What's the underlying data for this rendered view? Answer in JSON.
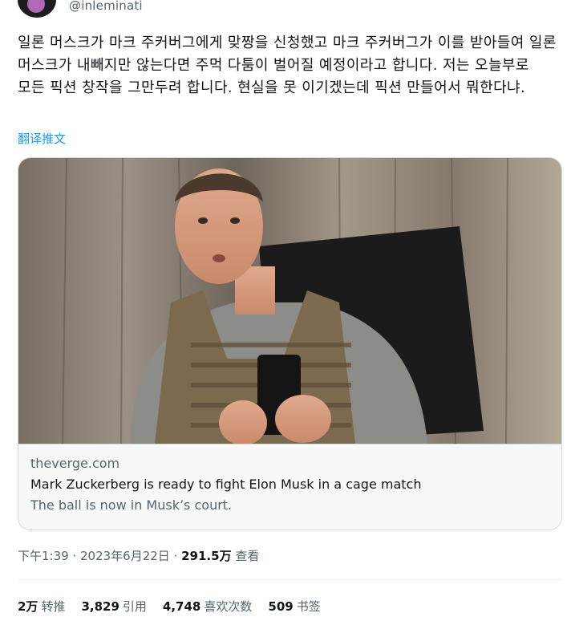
{
  "author": {
    "handle": "@inleminati"
  },
  "tweet": {
    "text": "일론 머스크가 마크 주커버그에게 맞짱을 신청했고 마크 주커버그가 이를 받아들여 일론 머스크가 내빼지만 않는다면 주먹 다툼이 벌어질 예정이라고 합니다. 저는 오늘부로 모든 픽션 창작을 그만두려 합니다. 현실을 못 이기겠는데 픽션 만들어서 뭐한다냐.",
    "translate_label": "翻译推文"
  },
  "card": {
    "domain": "theverge.com",
    "title": "Mark Zuckerberg is ready to fight Elon Musk in a cage match",
    "description": "The ball is now in Musk’s court."
  },
  "meta": {
    "time": "下午1:39",
    "separator": " · ",
    "date": "2023年6月22日",
    "views_count": "291.5万",
    "views_label": "查看"
  },
  "stats": {
    "retweets_count": "2万",
    "retweets_label": "转推",
    "quotes_count": "3,829",
    "quotes_label": "引用",
    "likes_count": "4,748",
    "likes_label": "喜欢次数",
    "bookmarks_count": "509",
    "bookmarks_label": "书签"
  },
  "colors": {
    "link": "#1d9bf0",
    "secondary_text": "#536471",
    "primary_text": "#0f1419",
    "border": "#cfd9de"
  }
}
